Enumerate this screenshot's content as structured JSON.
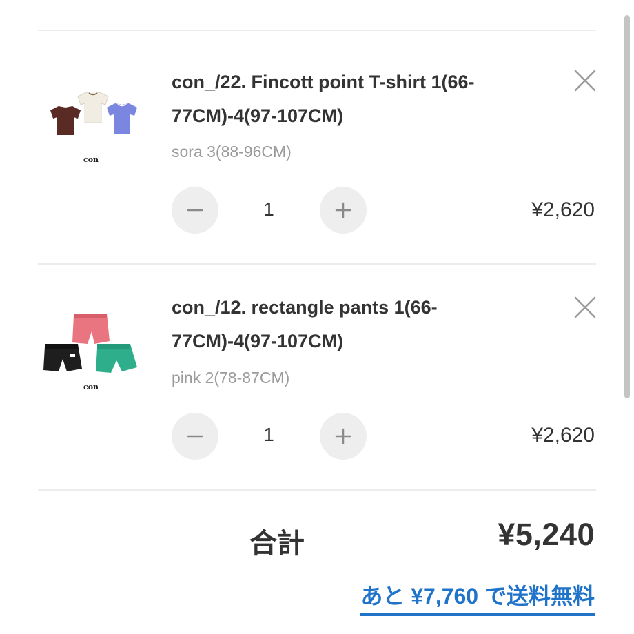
{
  "cart": {
    "items": [
      {
        "name": "con_/22. Fincott point T-shirt 1(66-77CM)-4(97-107CM)",
        "variant": "sora 3(88-96CM)",
        "quantity": "1",
        "price": "¥2,620",
        "thumbnail_caption": "con"
      },
      {
        "name": "con_/12. rectangle pants 1(66-77CM)-4(97-107CM)",
        "variant": "pink 2(78-87CM)",
        "quantity": "1",
        "price": "¥2,620",
        "thumbnail_caption": "con"
      }
    ],
    "total_label": "合計",
    "total_value": "¥5,240",
    "free_shipping": {
      "prefix": "あと",
      "amount": "¥7,760",
      "suffix": "で送料無料"
    }
  },
  "icons": {
    "remove": "close-icon",
    "decrement": "minus-icon",
    "increment": "plus-icon"
  },
  "colors": {
    "text": "#333333",
    "muted": "#9a9a9a",
    "link": "#1f73c9",
    "button_bg": "#eeeeee",
    "divider": "#ececec"
  }
}
